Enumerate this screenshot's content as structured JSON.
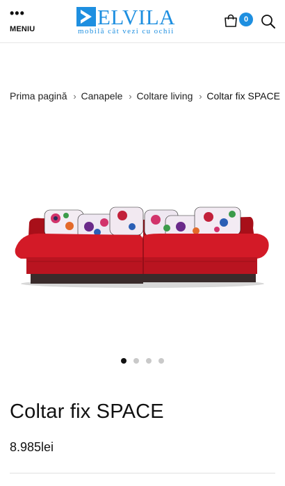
{
  "header": {
    "menu_icon": "more-dots-icon",
    "menu_label": "MENIU",
    "logo_text": "ELVILA",
    "logo_tagline": "mobilă cât vezi cu ochii",
    "cart_icon": "shopping-bag-icon",
    "cart_count": "0",
    "search_icon": "search-icon",
    "brand_color": "#1e8fe0"
  },
  "breadcrumb": {
    "items": [
      "Prima pagină",
      "Canapele",
      "Coltare living"
    ],
    "current": "Coltar fix SPACE",
    "separator_icon": "chevron-right-icon"
  },
  "gallery": {
    "image_count": 4,
    "active_index": 0,
    "sofa_color": "#c8141f"
  },
  "product": {
    "title": "Coltar fix SPACE",
    "price": "8.985lei"
  }
}
